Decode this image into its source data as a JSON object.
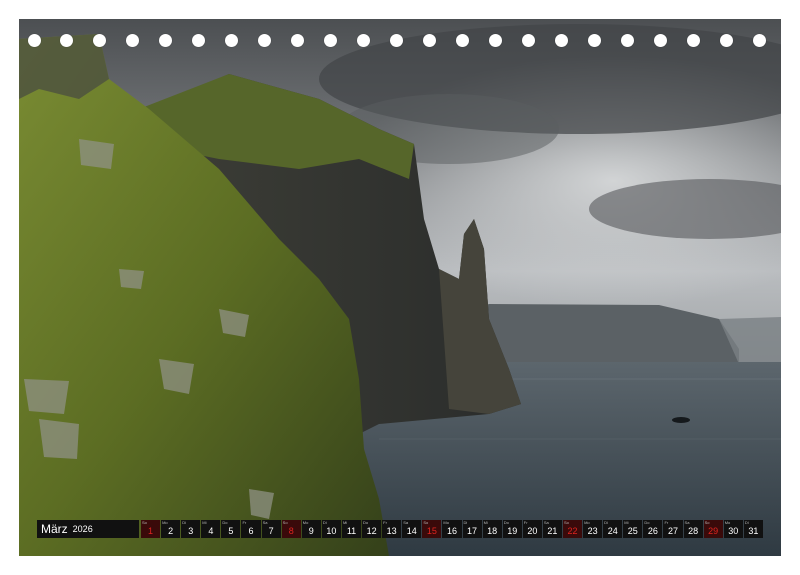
{
  "calendar": {
    "month": "März",
    "year": "2026",
    "days": [
      {
        "wd": "So",
        "num": "1",
        "sunday": true
      },
      {
        "wd": "Mo",
        "num": "2",
        "sunday": false
      },
      {
        "wd": "Di",
        "num": "3",
        "sunday": false
      },
      {
        "wd": "Mi",
        "num": "4",
        "sunday": false
      },
      {
        "wd": "Do",
        "num": "5",
        "sunday": false
      },
      {
        "wd": "Fr",
        "num": "6",
        "sunday": false
      },
      {
        "wd": "Sa",
        "num": "7",
        "sunday": false
      },
      {
        "wd": "So",
        "num": "8",
        "sunday": true
      },
      {
        "wd": "Mo",
        "num": "9",
        "sunday": false
      },
      {
        "wd": "Di",
        "num": "10",
        "sunday": false
      },
      {
        "wd": "Mi",
        "num": "11",
        "sunday": false
      },
      {
        "wd": "Do",
        "num": "12",
        "sunday": false
      },
      {
        "wd": "Fr",
        "num": "13",
        "sunday": false
      },
      {
        "wd": "Sa",
        "num": "14",
        "sunday": false
      },
      {
        "wd": "So",
        "num": "15",
        "sunday": true
      },
      {
        "wd": "Mo",
        "num": "16",
        "sunday": false
      },
      {
        "wd": "Di",
        "num": "17",
        "sunday": false
      },
      {
        "wd": "Mi",
        "num": "18",
        "sunday": false
      },
      {
        "wd": "Do",
        "num": "19",
        "sunday": false
      },
      {
        "wd": "Fr",
        "num": "20",
        "sunday": false
      },
      {
        "wd": "Sa",
        "num": "21",
        "sunday": false
      },
      {
        "wd": "So",
        "num": "22",
        "sunday": true
      },
      {
        "wd": "Mo",
        "num": "23",
        "sunday": false
      },
      {
        "wd": "Di",
        "num": "24",
        "sunday": false
      },
      {
        "wd": "Mi",
        "num": "25",
        "sunday": false
      },
      {
        "wd": "Do",
        "num": "26",
        "sunday": false
      },
      {
        "wd": "Fr",
        "num": "27",
        "sunday": false
      },
      {
        "wd": "Sa",
        "num": "28",
        "sunday": false
      },
      {
        "wd": "So",
        "num": "29",
        "sunday": true
      },
      {
        "wd": "Mo",
        "num": "30",
        "sunday": false
      },
      {
        "wd": "Di",
        "num": "31",
        "sunday": false
      }
    ]
  },
  "colors": {
    "bar": "#111111",
    "sunday_text": "#e0241f",
    "sky": "#6f7275",
    "sea": "#39424a",
    "grass": "#5d6e25"
  },
  "binding_holes": 23
}
